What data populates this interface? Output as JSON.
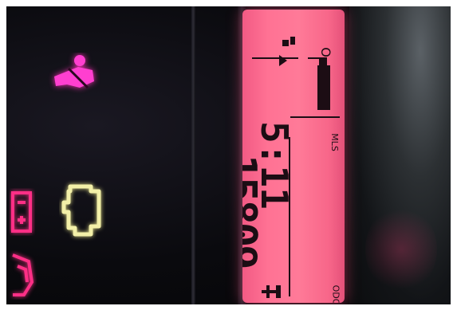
{
  "lcd": {
    "odometer_value": "15809",
    "odometer_unit": "MLS",
    "odometer_label": "ODO",
    "clock_time": "5:11",
    "fuel_empty_mark": "E",
    "fuel_low_mark": "O"
  },
  "warning_lights": [
    {
      "icon": "seatbelt-warning-icon",
      "color": "#ff3fd0"
    },
    {
      "icon": "check-engine-icon",
      "color": "#f3f0a8"
    },
    {
      "icon": "battery-warning-icon",
      "color": "#ff2f86"
    },
    {
      "icon": "door-ajar-icon",
      "color": "#ff2f86"
    }
  ],
  "colors": {
    "lcd_backlight": "#ff7294",
    "segment": "#1c0d14",
    "dash": "#07070a"
  }
}
